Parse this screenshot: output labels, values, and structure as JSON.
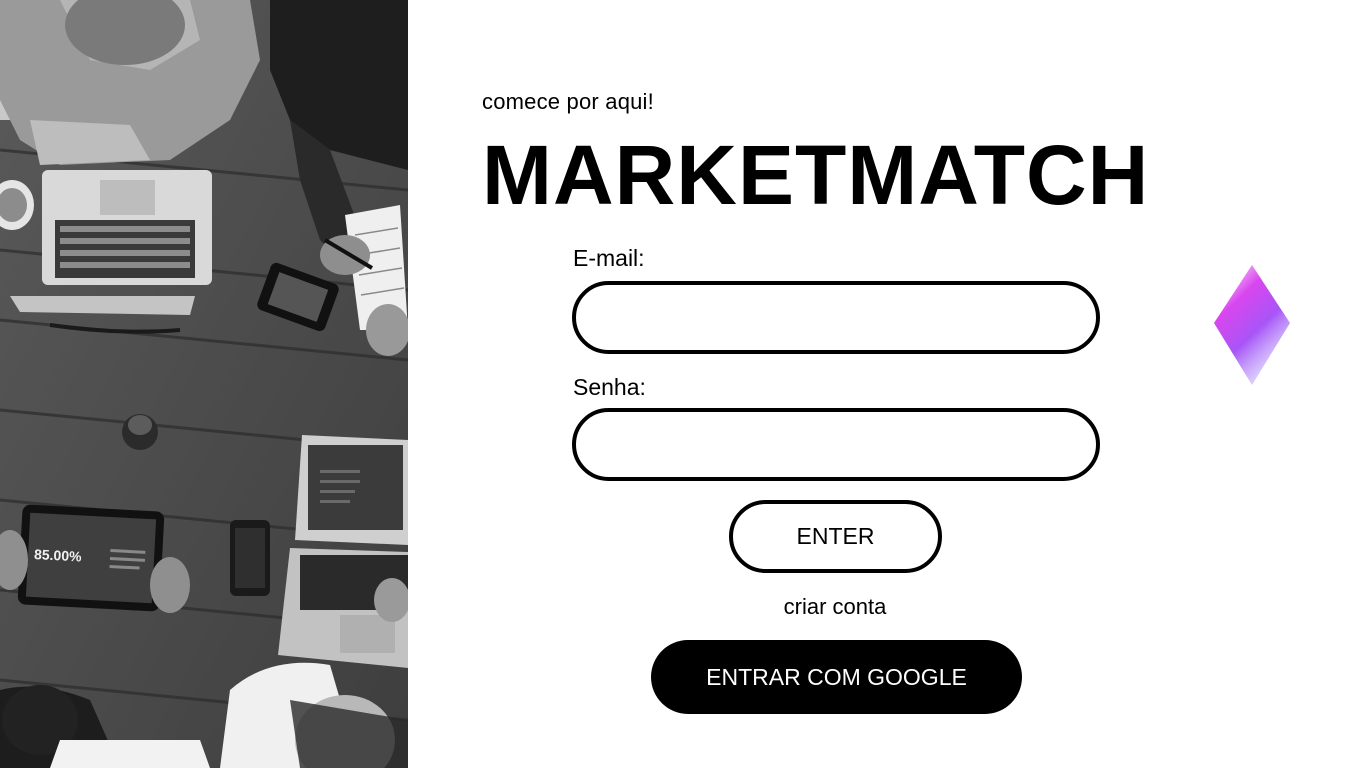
{
  "hero": {
    "tagline": "comece por aqui!",
    "brand": "MARKETMATCH"
  },
  "form": {
    "email_label": "E-mail:",
    "email_value": "",
    "password_label": "Senha:",
    "password_value": "",
    "enter_label": "ENTER",
    "create_account_label": "criar conta",
    "google_label": "ENTRAR COM GOOGLE"
  },
  "photo": {
    "tablet_text": "85.00%"
  },
  "colors": {
    "accent_light": "#e879f9",
    "accent_dark": "#9333ea",
    "primary": "#000000",
    "background": "#ffffff"
  }
}
